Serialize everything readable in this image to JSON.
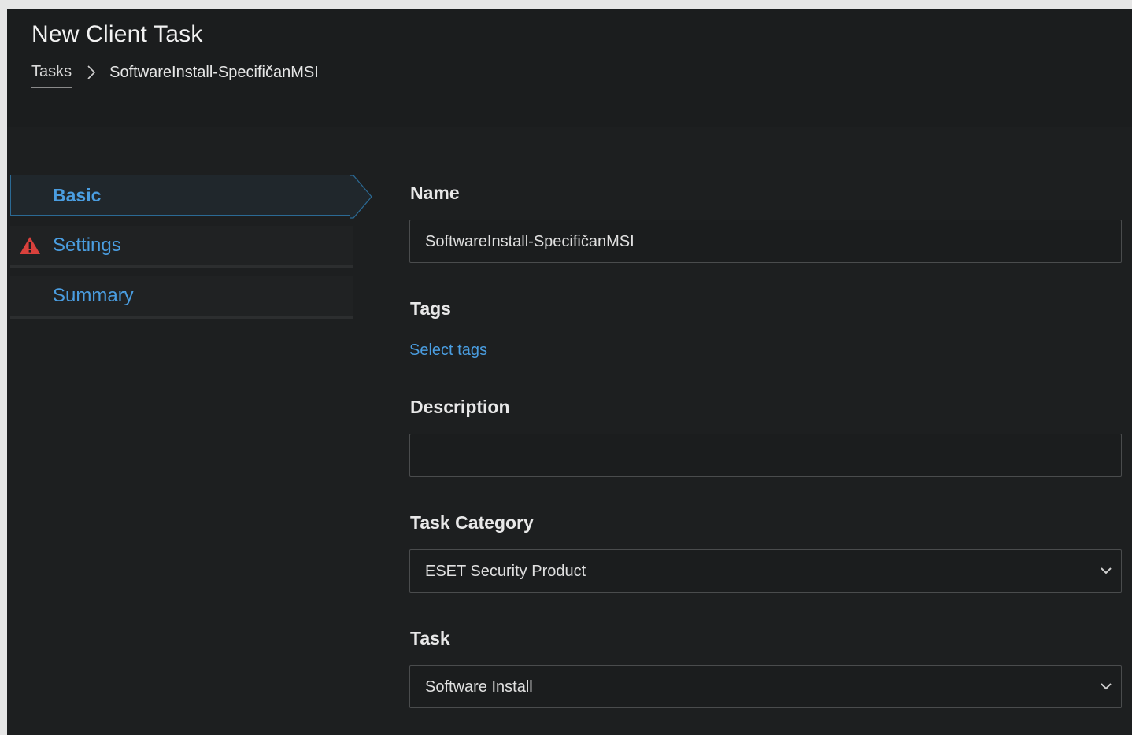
{
  "header": {
    "title": "New Client Task",
    "breadcrumb": {
      "root": "Tasks",
      "current": "SoftwareInstall-SpecifičanMSI"
    }
  },
  "sidebar": {
    "items": [
      {
        "label": "Basic",
        "active": true,
        "warning": false
      },
      {
        "label": "Settings",
        "active": false,
        "warning": true
      },
      {
        "label": "Summary",
        "active": false,
        "warning": false
      }
    ]
  },
  "form": {
    "name": {
      "label": "Name",
      "value": "SoftwareInstall-SpecifičanMSI"
    },
    "tags": {
      "label": "Tags",
      "link": "Select tags"
    },
    "description": {
      "label": "Description",
      "value": ""
    },
    "task_category": {
      "label": "Task Category",
      "value": "ESET Security Product"
    },
    "task": {
      "label": "Task",
      "value": "Software Install"
    }
  },
  "colors": {
    "accent": "#4a9de0",
    "warning": "#d9413c",
    "background": "#1d1f20"
  }
}
